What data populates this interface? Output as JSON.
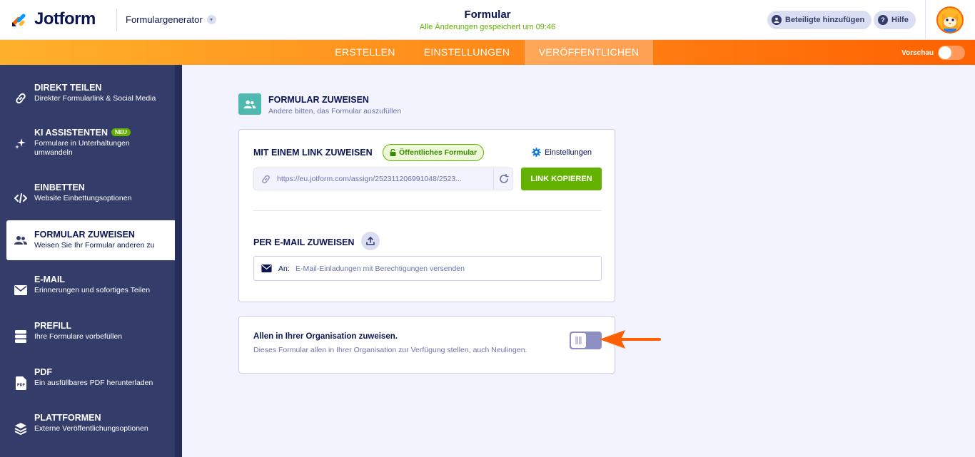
{
  "header": {
    "logo_text": "Jotform",
    "form_generator": "Formulargenerator",
    "title": "Formular",
    "saved_status": "Alle Änderungen gespeichert um 09:46",
    "add_participants": "Beteiligte hinzufügen",
    "help": "Hilfe"
  },
  "nav": {
    "tabs": [
      "ERSTELLEN",
      "EINSTELLUNGEN",
      "VERÖFFENTLICHEN"
    ],
    "active_tab": "VERÖFFENTLICHEN",
    "preview_label": "Vorschau",
    "preview_on": false
  },
  "sidebar": {
    "items": [
      {
        "title": "DIREKT TEILEN",
        "subtitle": "Direkter Formularlink & Social Media",
        "icon": "link-icon"
      },
      {
        "title": "KI ASSISTENTEN",
        "badge": "NEU",
        "subtitle": "Formulare in Unterhaltungen umwandeln",
        "icon": "sparkle-icon"
      },
      {
        "title": "EINBETTEN",
        "subtitle": "Website Einbettungsoptionen",
        "icon": "code-icon"
      },
      {
        "title": "FORMULAR ZUWEISEN",
        "subtitle": "Weisen Sie Ihr Formular anderen zu",
        "icon": "users-icon",
        "active": true
      },
      {
        "title": "E-MAIL",
        "subtitle": "Erinnerungen und sofortiges Teilen",
        "icon": "envelope-icon"
      },
      {
        "title": "PREFILL",
        "subtitle": "Ihre Formulare vorbefüllen",
        "icon": "prefill-icon"
      },
      {
        "title": "PDF",
        "subtitle": "Ein ausfüllbares PDF herunterladen",
        "icon": "pdf-icon"
      },
      {
        "title": "PLATTFORMEN",
        "subtitle": "Externe Veröffentlichungsoptionen",
        "icon": "layers-icon"
      }
    ]
  },
  "section": {
    "title": "FORMULAR ZUWEISEN",
    "subtitle": "Andere bitten, das Formular auszufüllen"
  },
  "link_assign": {
    "label": "MIT EINEM LINK ZUWEISEN",
    "badge": "Öffentliches Formular",
    "settings": "Einstellungen",
    "url": "https://eu.jotform.com/assign/252311206991048/2523...",
    "copy_button": "LINK KOPIEREN"
  },
  "email_assign": {
    "label": "PER E-MAIL ZUWEISEN",
    "to_label": "An:",
    "placeholder": "E-Mail-Einladungen mit Berechtigungen versenden"
  },
  "org_assign": {
    "title": "Allen in Ihrer Organisation zuweisen.",
    "subtitle": "Dieses Formular allen in Ihrer Organisation zur Verfügung stellen, auch Neulingen.",
    "enabled": false
  },
  "colors": {
    "accent_orange": "#ff6100",
    "green": "#64b200",
    "navy": "#343c6a",
    "teal": "#4eb9b0"
  }
}
